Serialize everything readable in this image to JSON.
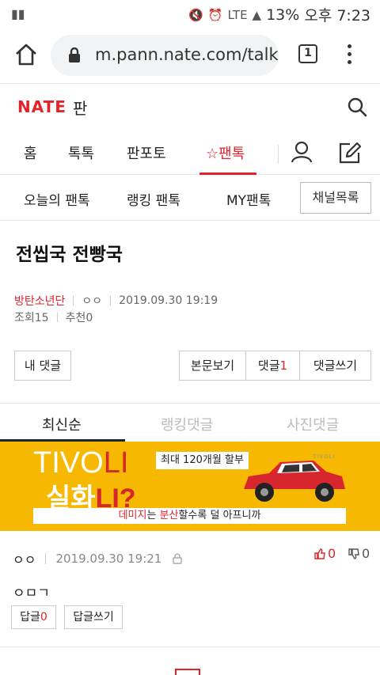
{
  "status_bar": {
    "battery": "13%",
    "time": "오후 7:23",
    "network": "LTE"
  },
  "browser": {
    "url": "m.pann.nate.com/talk/rep",
    "tab_count": "1"
  },
  "header": {
    "logo": "NATE",
    "section": "판"
  },
  "main_nav": {
    "items": [
      "홈",
      "톡톡",
      "판포토"
    ],
    "active": "☆팬톡"
  },
  "sub_nav": {
    "items": [
      "오늘의 팬톡",
      "랭킹 팬톡",
      "MY팬톡"
    ],
    "channel_button": "채널목록"
  },
  "post": {
    "title": "전씹국 전빵국",
    "channel": "방탄소년단",
    "author": "ㅇㅇ",
    "date": "2019.09.30 19:19",
    "views": "조회15",
    "recommends": "추천0"
  },
  "actions": {
    "my_comments": "내 댓글",
    "view_body": "본문보기",
    "comments_label": "댓글",
    "comments_count": "1",
    "write_comment": "댓글쓰기"
  },
  "comment_tabs": [
    "최신순",
    "랭킹댓글",
    "사진댓글"
  ],
  "ad": {
    "line1_a": "TIVO",
    "line1_b": "LI",
    "line2_a": "실화",
    "line2_b": "LI?",
    "promo": "최대 120개월 할부",
    "strip_a": "데미지",
    "strip_b": "는 ",
    "strip_c": "분산",
    "strip_d": "할수록 덜 아프니까",
    "brand": "TIVOLI"
  },
  "comment": {
    "nick": "ㅇㅇ",
    "date": "2019.09.30 19:21",
    "up": "0",
    "down": "0",
    "text": "ㅇㅁㄱ",
    "reply_label": "답글",
    "reply_count": "0",
    "write_reply": "답글쓰기"
  },
  "colors": {
    "brand_red": "#e5222a",
    "ad_yellow": "#f6b800"
  }
}
